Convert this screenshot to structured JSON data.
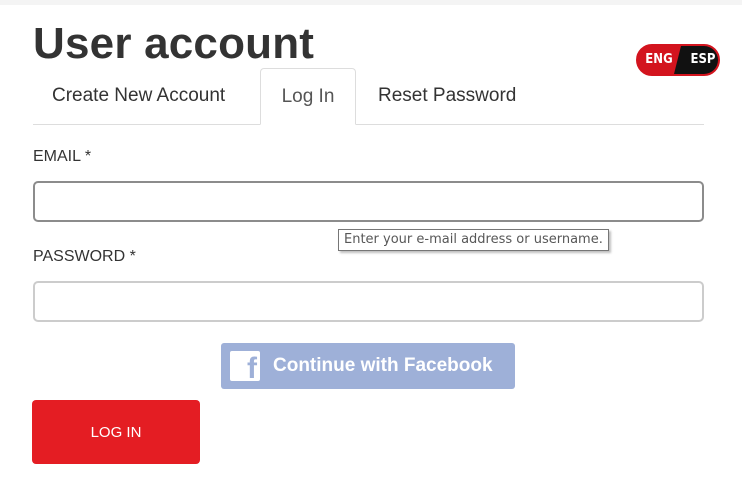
{
  "page": {
    "title": "User account"
  },
  "language_toggle": {
    "options": [
      "ENG",
      "ESP"
    ],
    "active": "ESP"
  },
  "tabs": [
    {
      "label": "Create New Account",
      "active": false
    },
    {
      "label": "Log In",
      "active": true
    },
    {
      "label": "Reset Password",
      "active": false
    }
  ],
  "form": {
    "email_label": "EMAIL *",
    "email_value": "",
    "email_tooltip": "Enter your e-mail address or username.",
    "password_label": "PASSWORD *",
    "password_value": ""
  },
  "facebook_button": {
    "icon": "facebook-icon",
    "label": "Continue with Facebook",
    "color": "#9eb0d8"
  },
  "login_button": {
    "label": "LOG IN",
    "color": "#e41d23"
  }
}
